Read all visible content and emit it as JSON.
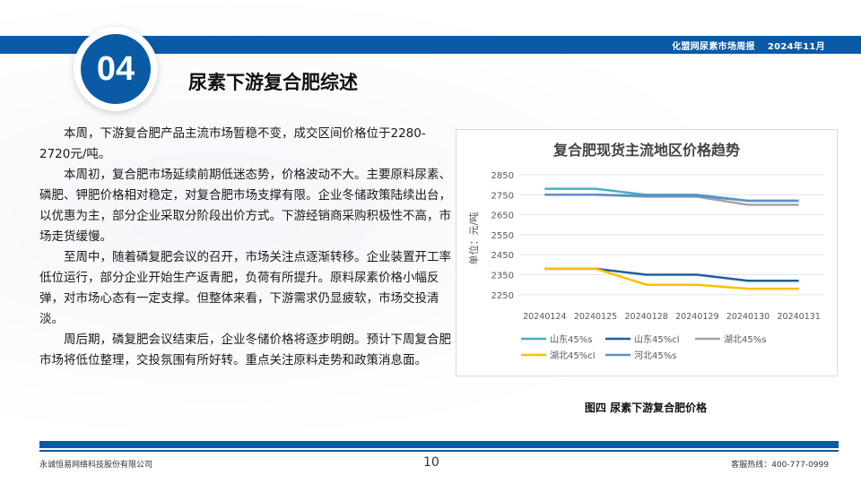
{
  "header": {
    "publisher": "化盟网尿素市场周报",
    "date": "2024年11月"
  },
  "section": {
    "number": "04",
    "title": "尿素下游复合肥综述"
  },
  "paragraphs": [
    "本周，下游复合肥产品主流市场暂稳不变，成交区间价格位于2280-2720元/吨。",
    "本周初，复合肥市场延续前期低迷态势，价格波动不大。主要原料尿素、磷肥、钾肥价格相对稳定，对复合肥市场支撑有限。企业冬储政策陆续出台，以优惠为主，部分企业采取分阶段出价方式。下游经销商采购积极性不高，市场走货缓慢。",
    "至周中，随着磷复肥会议的召开，市场关注点逐渐转移。企业装置开工率低位运行，部分企业开始生产返青肥，负荷有所提升。原料尿素价格小幅反弹，对市场心态有一定支撑。但整体来看，下游需求仍显疲软，市场交投清淡。",
    "周后期，磷复肥会议结束后，企业冬储价格将逐步明朗。预计下周复合肥市场将低位整理，交投氛围有所好转。重点关注原料走势和政策消息面。"
  ],
  "chart_data": {
    "type": "line",
    "title": "复合肥现货主流地区价格趋势",
    "ylabel": "单位：元/吨",
    "xlabel": "",
    "categories": [
      "20240124",
      "20240125",
      "20240128",
      "20240129",
      "20240130",
      "20240131"
    ],
    "ylim": [
      2200,
      2850
    ],
    "yticks": [
      2250,
      2350,
      2450,
      2550,
      2650,
      2750,
      2850
    ],
    "grid": true,
    "legend_position": "bottom",
    "series": [
      {
        "name": "山东45%s",
        "color": "#4bacc6",
        "values": [
          2780,
          2780,
          2750,
          2750,
          2720,
          2720
        ]
      },
      {
        "name": "山东45%cl",
        "color": "#1f5fa0",
        "values": [
          2380,
          2380,
          2350,
          2350,
          2320,
          2320
        ]
      },
      {
        "name": "湖北45%s",
        "color": "#a5a5a5",
        "values": [
          2750,
          2750,
          2740,
          2740,
          2700,
          2700
        ]
      },
      {
        "name": "湖北45%cl",
        "color": "#ffc000",
        "values": [
          2380,
          2380,
          2300,
          2300,
          2280,
          2280
        ]
      },
      {
        "name": "河北45%s",
        "color": "#5b8fd1",
        "values": [
          2750,
          2750,
          2745,
          2745,
          2720,
          2720
        ]
      }
    ]
  },
  "figure_caption": "图四 尿素下游复合肥价格",
  "footer": {
    "company": "永诚恒易网络科技股份有限公司",
    "page": "10",
    "hotline": "客服热线：400-777-0999"
  }
}
